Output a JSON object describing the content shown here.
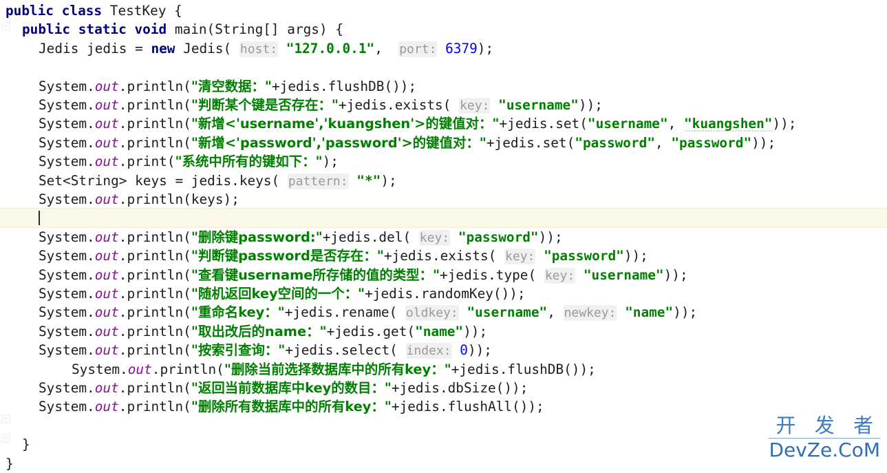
{
  "editor": {
    "language": "java",
    "class_name": "TestKey",
    "colors": {
      "background": "#ffffff",
      "text": "#1c1c1c",
      "keyword": "#000080",
      "string": "#008000",
      "number": "#0000ff",
      "static_field": "#871094",
      "param_hint": "#9a9a9a",
      "param_hint_bg": "#f0f0f0",
      "caret_line_bg": "#fcf8e9",
      "watermark": "#2f6eb5"
    },
    "caret_line_index": 9
  },
  "lines": [
    {
      "indent": 0,
      "tokens": [
        {
          "t": "public",
          "c": "kw"
        },
        {
          "t": " ",
          "c": "plain"
        },
        {
          "t": "class",
          "c": "kw"
        },
        {
          "t": " TestKey {",
          "c": "plain"
        }
      ]
    },
    {
      "indent": 1,
      "tokens": [
        {
          "t": "public",
          "c": "kw"
        },
        {
          "t": " ",
          "c": "plain"
        },
        {
          "t": "static",
          "c": "kw"
        },
        {
          "t": " ",
          "c": "plain"
        },
        {
          "t": "void",
          "c": "kw"
        },
        {
          "t": " main(String[] args) {",
          "c": "plain"
        }
      ]
    },
    {
      "indent": 2,
      "tokens": [
        {
          "t": "Jedis jedis = ",
          "c": "plain"
        },
        {
          "t": "new",
          "c": "kw"
        },
        {
          "t": " Jedis( ",
          "c": "plain"
        },
        {
          "t": "host:",
          "c": "hint"
        },
        {
          "t": " ",
          "c": "plain"
        },
        {
          "t": "\"127.0.0.1\"",
          "c": "str"
        },
        {
          "t": ",  ",
          "c": "plain"
        },
        {
          "t": "port:",
          "c": "hint"
        },
        {
          "t": " ",
          "c": "plain"
        },
        {
          "t": "6379",
          "c": "num"
        },
        {
          "t": ");",
          "c": "plain"
        }
      ]
    },
    {
      "indent": 0,
      "tokens": []
    },
    {
      "indent": 2,
      "tokens": [
        {
          "t": "System.",
          "c": "plain"
        },
        {
          "t": "out",
          "c": "field"
        },
        {
          "t": ".println(",
          "c": "plain"
        },
        {
          "t": "\"清空数据：\"",
          "c": "strcn"
        },
        {
          "t": "+jedis.flushDB());",
          "c": "plain"
        }
      ]
    },
    {
      "indent": 2,
      "tokens": [
        {
          "t": "System.",
          "c": "plain"
        },
        {
          "t": "out",
          "c": "field"
        },
        {
          "t": ".println(",
          "c": "plain"
        },
        {
          "t": "\"判断某个键是否存在：\"",
          "c": "strcn"
        },
        {
          "t": "+jedis.exists( ",
          "c": "plain"
        },
        {
          "t": "key:",
          "c": "hint"
        },
        {
          "t": " ",
          "c": "plain"
        },
        {
          "t": "\"username\"",
          "c": "str"
        },
        {
          "t": "));",
          "c": "plain"
        }
      ]
    },
    {
      "indent": 2,
      "tokens": [
        {
          "t": "System.",
          "c": "plain"
        },
        {
          "t": "out",
          "c": "field"
        },
        {
          "t": ".println(",
          "c": "plain"
        },
        {
          "t": "\"新增<'username','kuangshen'>的键值对：\"",
          "c": "strcn"
        },
        {
          "t": "+jedis.set(",
          "c": "plain"
        },
        {
          "t": "\"username\"",
          "c": "str"
        },
        {
          "t": ", ",
          "c": "plain"
        },
        {
          "t": "\"kuangshen\"",
          "c": "str typo"
        },
        {
          "t": "));",
          "c": "plain"
        }
      ]
    },
    {
      "indent": 2,
      "tokens": [
        {
          "t": "System.",
          "c": "plain"
        },
        {
          "t": "out",
          "c": "field"
        },
        {
          "t": ".println(",
          "c": "plain"
        },
        {
          "t": "\"新增<'password','password'>的键值对：\"",
          "c": "strcn"
        },
        {
          "t": "+jedis.set(",
          "c": "plain"
        },
        {
          "t": "\"password\"",
          "c": "str"
        },
        {
          "t": ", ",
          "c": "plain"
        },
        {
          "t": "\"password\"",
          "c": "str"
        },
        {
          "t": "));",
          "c": "plain"
        }
      ]
    },
    {
      "indent": 2,
      "tokens": [
        {
          "t": "System.",
          "c": "plain"
        },
        {
          "t": "out",
          "c": "field"
        },
        {
          "t": ".print(",
          "c": "plain"
        },
        {
          "t": "\"系统中所有的键如下：\"",
          "c": "strcn"
        },
        {
          "t": ");",
          "c": "plain"
        }
      ]
    },
    {
      "indent": 2,
      "tokens": [
        {
          "t": "Set<String> keys = jedis.keys( ",
          "c": "plain"
        },
        {
          "t": "pattern:",
          "c": "hint"
        },
        {
          "t": " ",
          "c": "plain"
        },
        {
          "t": "\"*\"",
          "c": "str"
        },
        {
          "t": ");",
          "c": "plain"
        }
      ]
    },
    {
      "indent": 2,
      "tokens": [
        {
          "t": "System.",
          "c": "plain"
        },
        {
          "t": "out",
          "c": "field"
        },
        {
          "t": ".println(keys);",
          "c": "plain"
        }
      ]
    },
    {
      "indent": 2,
      "tokens": [],
      "caret": true
    },
    {
      "indent": 2,
      "tokens": [
        {
          "t": "System.",
          "c": "plain"
        },
        {
          "t": "out",
          "c": "field"
        },
        {
          "t": ".println(",
          "c": "plain"
        },
        {
          "t": "\"删除键password:\"",
          "c": "strcn"
        },
        {
          "t": "+jedis.del( ",
          "c": "plain"
        },
        {
          "t": "key:",
          "c": "hint"
        },
        {
          "t": " ",
          "c": "plain"
        },
        {
          "t": "\"password\"",
          "c": "str"
        },
        {
          "t": "));",
          "c": "plain"
        }
      ]
    },
    {
      "indent": 2,
      "tokens": [
        {
          "t": "System.",
          "c": "plain"
        },
        {
          "t": "out",
          "c": "field"
        },
        {
          "t": ".println(",
          "c": "plain"
        },
        {
          "t": "\"判断键password是否存在：\"",
          "c": "strcn"
        },
        {
          "t": "+jedis.exists( ",
          "c": "plain"
        },
        {
          "t": "key:",
          "c": "hint"
        },
        {
          "t": " ",
          "c": "plain"
        },
        {
          "t": "\"password\"",
          "c": "str"
        },
        {
          "t": "));",
          "c": "plain"
        }
      ]
    },
    {
      "indent": 2,
      "tokens": [
        {
          "t": "System.",
          "c": "plain"
        },
        {
          "t": "out",
          "c": "field"
        },
        {
          "t": ".println(",
          "c": "plain"
        },
        {
          "t": "\"查看键username所存储的值的类型：\"",
          "c": "strcn"
        },
        {
          "t": "+jedis.type( ",
          "c": "plain"
        },
        {
          "t": "key:",
          "c": "hint"
        },
        {
          "t": " ",
          "c": "plain"
        },
        {
          "t": "\"username\"",
          "c": "str"
        },
        {
          "t": "));",
          "c": "plain"
        }
      ]
    },
    {
      "indent": 2,
      "tokens": [
        {
          "t": "System.",
          "c": "plain"
        },
        {
          "t": "out",
          "c": "field"
        },
        {
          "t": ".println(",
          "c": "plain"
        },
        {
          "t": "\"随机返回key空间的一个：\"",
          "c": "strcn"
        },
        {
          "t": "+jedis.randomKey());",
          "c": "plain"
        }
      ]
    },
    {
      "indent": 2,
      "tokens": [
        {
          "t": "System.",
          "c": "plain"
        },
        {
          "t": "out",
          "c": "field"
        },
        {
          "t": ".println(",
          "c": "plain"
        },
        {
          "t": "\"重命名key：\"",
          "c": "strcn"
        },
        {
          "t": "+jedis.rename( ",
          "c": "plain"
        },
        {
          "t": "oldkey:",
          "c": "hint"
        },
        {
          "t": " ",
          "c": "plain"
        },
        {
          "t": "\"username\"",
          "c": "str"
        },
        {
          "t": ", ",
          "c": "plain"
        },
        {
          "t": "newkey:",
          "c": "hint"
        },
        {
          "t": " ",
          "c": "plain"
        },
        {
          "t": "\"name\"",
          "c": "str"
        },
        {
          "t": "));",
          "c": "plain"
        }
      ]
    },
    {
      "indent": 2,
      "tokens": [
        {
          "t": "System.",
          "c": "plain"
        },
        {
          "t": "out",
          "c": "field"
        },
        {
          "t": ".println(",
          "c": "plain"
        },
        {
          "t": "\"取出改后的name：\"",
          "c": "strcn"
        },
        {
          "t": "+jedis.get(",
          "c": "plain"
        },
        {
          "t": "\"name\"",
          "c": "str"
        },
        {
          "t": "));",
          "c": "plain"
        }
      ]
    },
    {
      "indent": 2,
      "tokens": [
        {
          "t": "System.",
          "c": "plain"
        },
        {
          "t": "out",
          "c": "field"
        },
        {
          "t": ".println(",
          "c": "plain"
        },
        {
          "t": "\"按索引查询：\"",
          "c": "strcn"
        },
        {
          "t": "+jedis.select( ",
          "c": "plain"
        },
        {
          "t": "index:",
          "c": "hint"
        },
        {
          "t": " ",
          "c": "plain"
        },
        {
          "t": "0",
          "c": "num"
        },
        {
          "t": "));",
          "c": "plain"
        }
      ]
    },
    {
      "indent": 4,
      "tokens": [
        {
          "t": "System.",
          "c": "plain"
        },
        {
          "t": "out",
          "c": "field"
        },
        {
          "t": ".println(",
          "c": "plain"
        },
        {
          "t": "\"删除当前选择数据库中的所有key：\"",
          "c": "strcn"
        },
        {
          "t": "+jedis.flushDB());",
          "c": "plain"
        }
      ]
    },
    {
      "indent": 2,
      "tokens": [
        {
          "t": "System.",
          "c": "plain"
        },
        {
          "t": "out",
          "c": "field"
        },
        {
          "t": ".println(",
          "c": "plain"
        },
        {
          "t": "\"返回当前数据库中key的数目：\"",
          "c": "strcn"
        },
        {
          "t": "+jedis.dbSize());",
          "c": "plain"
        }
      ]
    },
    {
      "indent": 2,
      "tokens": [
        {
          "t": "System.",
          "c": "plain"
        },
        {
          "t": "out",
          "c": "field"
        },
        {
          "t": ".println(",
          "c": "plain"
        },
        {
          "t": "\"删除所有数据库中的所有key：\"",
          "c": "strcn"
        },
        {
          "t": "+jedis.flushAll());",
          "c": "plain"
        }
      ]
    },
    {
      "indent": 0,
      "tokens": []
    },
    {
      "indent": 1,
      "tokens": [
        {
          "t": "}",
          "c": "plain"
        }
      ]
    },
    {
      "indent": 0,
      "tokens": [
        {
          "t": "}",
          "c": "plain"
        }
      ]
    }
  ],
  "watermark": {
    "cn": "开 发 者",
    "en": "DevZe.CoM"
  }
}
